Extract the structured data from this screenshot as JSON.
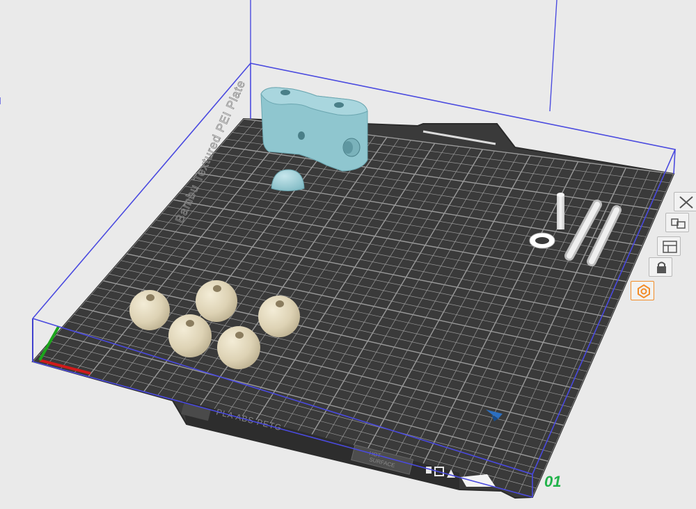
{
  "viewport": {
    "plate_label": "Bambu Textured PEI Plate",
    "plate_number": "01",
    "plate_materials": "PLA ABS PETG",
    "plate_badge_lines": [
      "HOT",
      "SURFACE"
    ]
  },
  "plate_toolbar": {
    "buttons": [
      {
        "name": "close-plate-button",
        "icon": "close-icon"
      },
      {
        "name": "arrange-objects-button",
        "icon": "arrange-icon"
      },
      {
        "name": "plate-settings-button",
        "icon": "settings-icon"
      },
      {
        "name": "lock-plate-button",
        "icon": "lock-icon"
      },
      {
        "name": "auto-orient-button",
        "icon": "orient-icon"
      }
    ]
  },
  "colors": {
    "background": "#eaeaea",
    "plate": "#3a3a3a",
    "grid": "#9a9a9a",
    "bounding_box": "#4a4adf",
    "part_blue": "#8fc6cf",
    "part_beige": "#ddd2b4",
    "part_white": "#e6e6e6",
    "axis_x": "#d11a1a",
    "axis_y": "#1ca51c",
    "plate_number": "#21b34a",
    "accent": "#f28c28"
  }
}
